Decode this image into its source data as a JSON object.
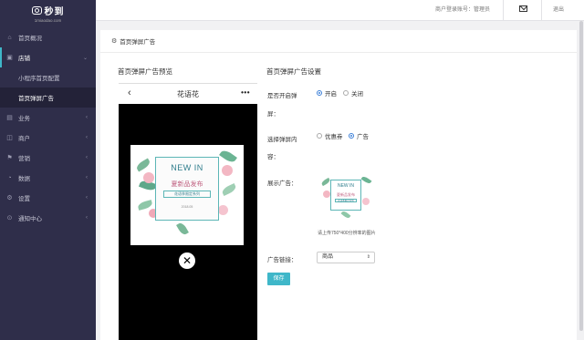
{
  "brand": {
    "name": "秒到",
    "domain": "1miaodao.com"
  },
  "sidebar": {
    "items": [
      {
        "label": "首页概况",
        "icon": "home-icon",
        "expandable": false
      },
      {
        "label": "店铺",
        "icon": "store-icon",
        "expandable": true,
        "expanded": true
      },
      {
        "label": "业务",
        "icon": "briefcase-icon",
        "expandable": true
      },
      {
        "label": "商户",
        "icon": "merchant-icon",
        "expandable": true
      },
      {
        "label": "营销",
        "icon": "marketing-icon",
        "expandable": true
      },
      {
        "label": "数据",
        "icon": "chart-icon",
        "expandable": true
      },
      {
        "label": "设置",
        "icon": "settings-icon",
        "expandable": true
      },
      {
        "label": "通知中心",
        "icon": "bell-icon",
        "expandable": true
      }
    ],
    "sub_items": [
      {
        "label": "小程序首页配置"
      },
      {
        "label": "首页弹屏广告",
        "active": true
      }
    ]
  },
  "topbar": {
    "user_text": "商户登录账号：管理员",
    "logout_label": "退出"
  },
  "panel": {
    "title": "首页弹屏广告"
  },
  "preview": {
    "title": "首页弹屏广告预览",
    "phone_title": "花语花",
    "back_glyph": "‹",
    "more_glyph": "•••",
    "close_glyph": "✕"
  },
  "ad": {
    "headline": "NEW IN",
    "title": "夏新品发布",
    "tag": "花语季限定系列",
    "date": "2018.05"
  },
  "settings": {
    "title": "首页弹屏广告设置",
    "popup_label_line1": "是否开启弹",
    "popup_label_line2": "屏：",
    "popup_options": [
      {
        "label": "开启",
        "selected": true
      },
      {
        "label": "关闭",
        "selected": false
      }
    ],
    "content_label_line1": "选择弹屏内",
    "content_label_line2": "容：",
    "content_options": [
      {
        "label": "优惠券",
        "selected": false
      },
      {
        "label": "广告",
        "selected": true
      }
    ],
    "display_label": "展示广告：",
    "hint": "请上传750*400分辨率的图片",
    "link_label": "广告链接：",
    "link_value": "商品",
    "save_label": "保存"
  },
  "colors": {
    "sidebar_bg": "#2f2e4a",
    "accent": "#3fb7c9",
    "radio_accent": "#3c7fd8"
  }
}
